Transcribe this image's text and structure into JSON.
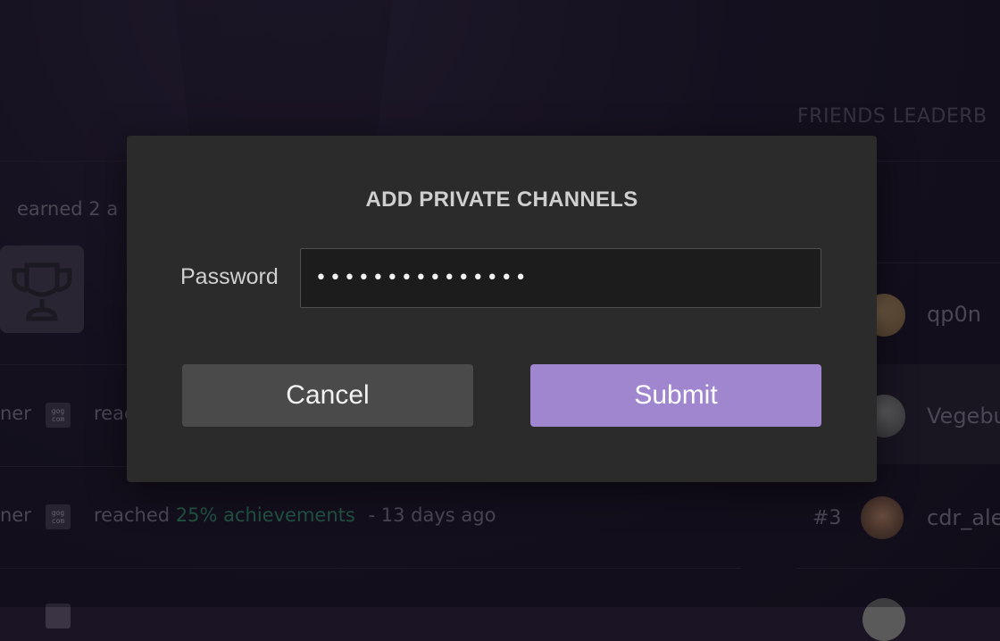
{
  "background": {
    "activity_partial_top": "earned 2 a",
    "activity_rows": [
      {
        "user_partial": "ner",
        "text_partial": "reac",
        "progress": "",
        "time": ""
      },
      {
        "user_partial": "ner",
        "text_partial": "reached",
        "progress": "25% achievements",
        "time": "- 13 days ago"
      }
    ],
    "gog_icon_text": [
      "gog",
      "com"
    ],
    "leaderboard": {
      "title_partial": "FRIENDS LEADERB",
      "rows": [
        {
          "rank": "",
          "name": "qp0n"
        },
        {
          "rank": "",
          "name": "Vegebu"
        },
        {
          "rank": "#3",
          "name": "cdr_ale"
        }
      ]
    }
  },
  "modal": {
    "title": "ADD PRIVATE CHANNELS",
    "password_label": "Password",
    "password_value": "•••••••••••••••",
    "cancel_label": "Cancel",
    "submit_label": "Submit"
  },
  "colors": {
    "modal_bg": "#2b2b2b",
    "submit_bg": "#9f86cf",
    "cancel_bg": "#4a4a4a",
    "accent_green": "#2f7a5e"
  }
}
